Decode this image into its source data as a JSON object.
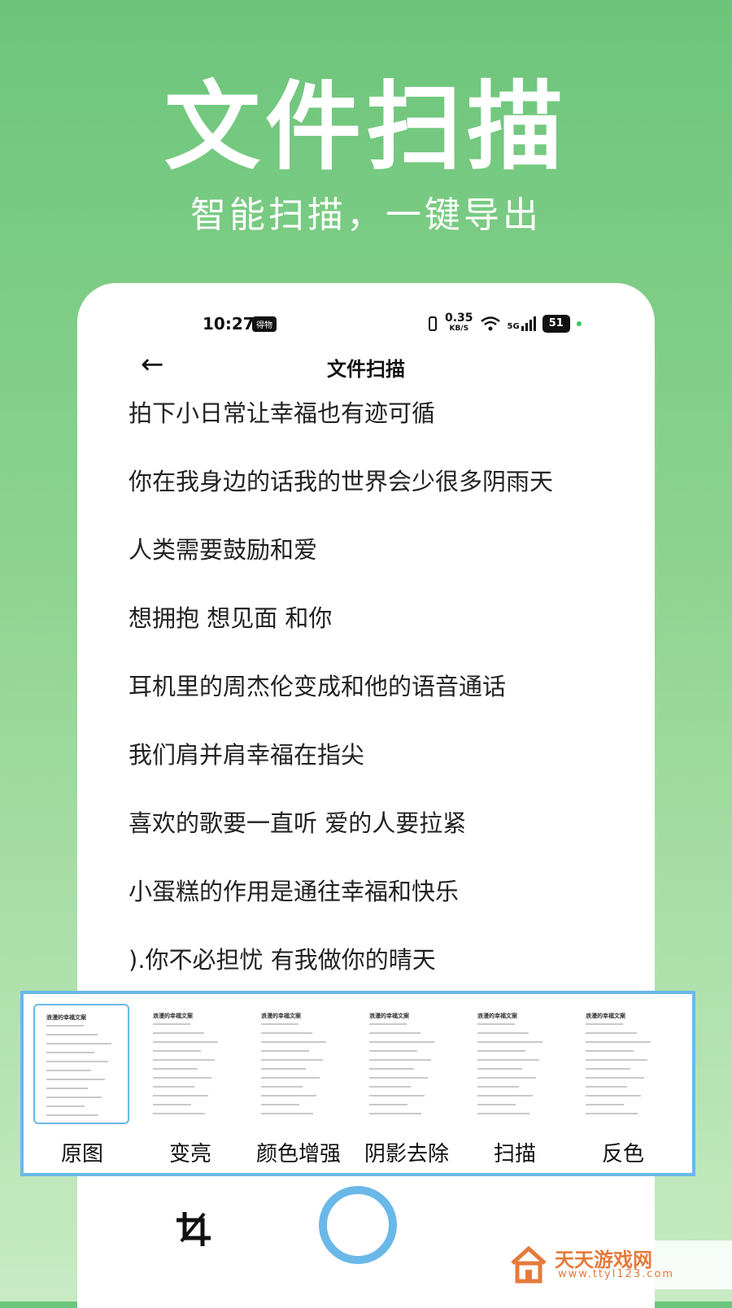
{
  "hero": {
    "title": "文件扫描",
    "subtitle": "智能扫描，一键导出"
  },
  "status_bar": {
    "time": "10:27",
    "app_badge": "得物",
    "speed": "0.35",
    "speed_unit": "KB/S",
    "network": "5G",
    "battery": "51"
  },
  "header": {
    "title": "文件扫描"
  },
  "lines": [
    "拍下小日常让幸福也有迹可循",
    "你在我身边的话我的世界会少很多阴雨天",
    "人类需要鼓励和爱",
    "想拥抱 想见面 和你",
    "耳机里的周杰伦变成和他的语音通话",
    "我们肩并肩幸福在指尖",
    "喜欢的歌要一直听 爱的人要拉紧",
    "小蛋糕的作用是通往幸福和快乐",
    ").你不必担忧 有我做你的晴天"
  ],
  "filters": {
    "thumb_title": "浪漫的幸福文案",
    "items": [
      {
        "label": "原图",
        "selected": true
      },
      {
        "label": "变亮",
        "selected": false
      },
      {
        "label": "颜色增强",
        "selected": false
      },
      {
        "label": "阴影去除",
        "selected": false
      },
      {
        "label": "扫描",
        "selected": false
      },
      {
        "label": "反色",
        "selected": false
      }
    ]
  },
  "watermark": {
    "name": "天天游戏网",
    "url": "www.ttyl123.com"
  },
  "colors": {
    "accent": "#6ab8e8",
    "green": "#6cc57a",
    "watermark": "#e57a3b"
  }
}
